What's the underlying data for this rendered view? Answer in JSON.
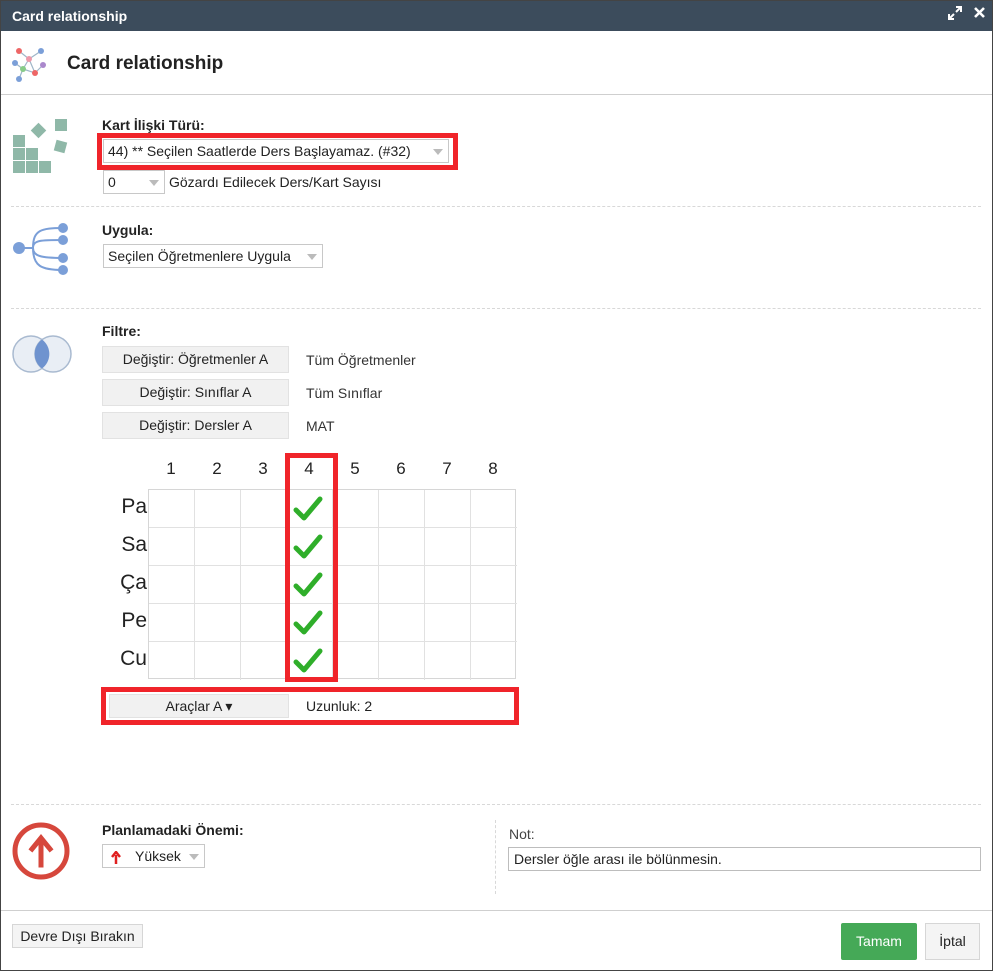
{
  "window": {
    "title": "Card relationship",
    "maximize_icon": "expand-icon",
    "close_icon": "close-icon"
  },
  "header": {
    "title": "Card relationship",
    "icon": "network-graph-icon"
  },
  "relation_type": {
    "label": "Kart İlişki Türü:",
    "selected": "44) ** Seçilen Saatlerde Ders Başlayamaz. (#32)",
    "ignore_count": "0",
    "ignore_label": "Gözardı Edilecek Ders/Kart Sayısı"
  },
  "apply": {
    "label": "Uygula:",
    "selected": "Seçilen Öğretmenlere Uygula"
  },
  "filter": {
    "label": "Filtre:",
    "rows": [
      {
        "button": "Değiştir: Öğretmenler A",
        "value": "Tüm Öğretmenler"
      },
      {
        "button": "Değiştir: Sınıflar A",
        "value": "Tüm Sınıflar"
      },
      {
        "button": "Değiştir: Dersler A",
        "value": "MAT"
      }
    ]
  },
  "timetable": {
    "periods": [
      "1",
      "2",
      "3",
      "4",
      "5",
      "6",
      "7",
      "8"
    ],
    "days": [
      "Pa",
      "Sa",
      "Ça",
      "Pe",
      "Cu"
    ],
    "checked_period": "4",
    "check_color": "#2fae2a",
    "tools_button": "Araçlar A ▾",
    "length_text": "Uzunluk: 2"
  },
  "importance": {
    "label": "Planlamadaki Önemi:",
    "selected": "Yüksek",
    "icon": "arrow-up-icon"
  },
  "note": {
    "label": "Not:",
    "value": "Dersler öğle arası ile bölünmesin."
  },
  "footer": {
    "disable_button": "Devre Dışı Bırakın",
    "ok_button": "Tamam",
    "cancel_button": "İptal"
  },
  "colors": {
    "titlebar": "#3c4c5c",
    "highlight_frame": "#f0242a",
    "ok_button": "#45a957"
  }
}
